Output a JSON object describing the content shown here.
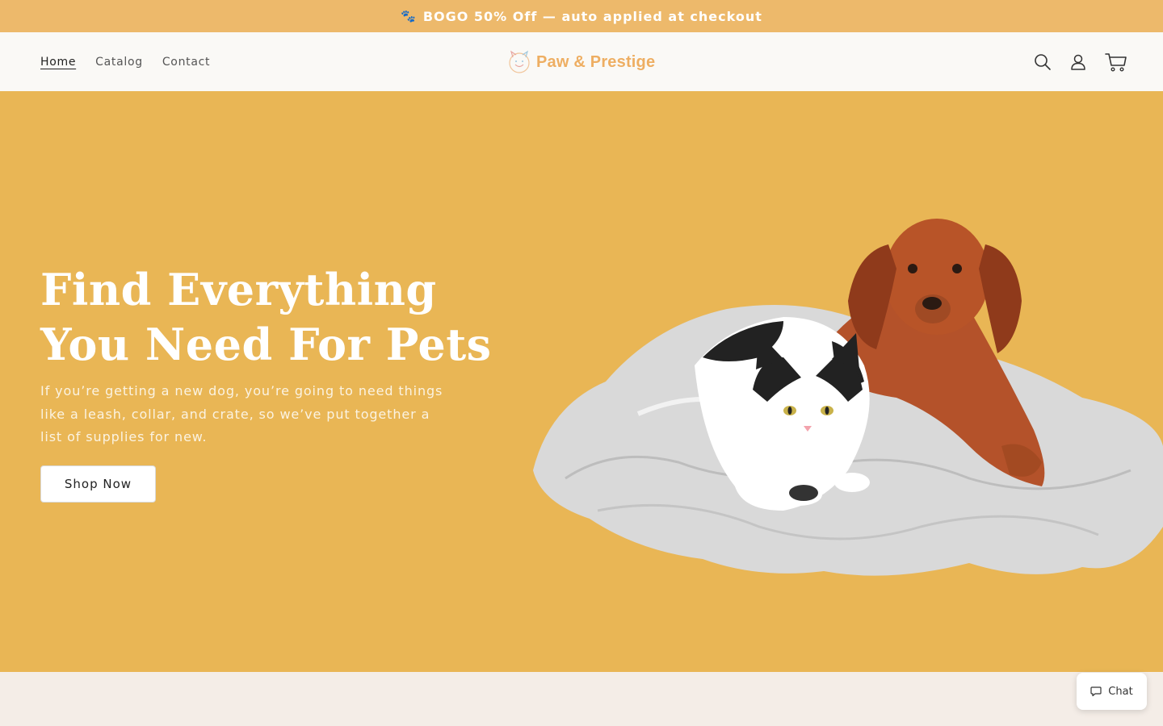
{
  "announcement": {
    "icon": "paw-icon",
    "text": "BOGO 50% Off — auto applied at checkout"
  },
  "nav": {
    "items": [
      {
        "label": "Home",
        "active": true
      },
      {
        "label": "Catalog"
      },
      {
        "label": "Contact"
      }
    ]
  },
  "logo": {
    "text": "Paw & Prestige",
    "icon": "pet-logo-icon"
  },
  "header_icons": [
    "search-icon",
    "account-icon",
    "cart-icon"
  ],
  "hero": {
    "title": "Find Everything You Need For Pets",
    "subtitle": "If you’re getting a new dog, you’re going to need things like a leash, collar, and crate, so we’ve put together a list of supplies for new.",
    "cta": "Shop Now"
  },
  "chat": {
    "label": "Chat"
  },
  "colors": {
    "announcement_bg": "#edb96b",
    "hero_bg": "#e9b655",
    "logo_accent": "#eeae62",
    "footer_bg": "#f4ede7"
  }
}
